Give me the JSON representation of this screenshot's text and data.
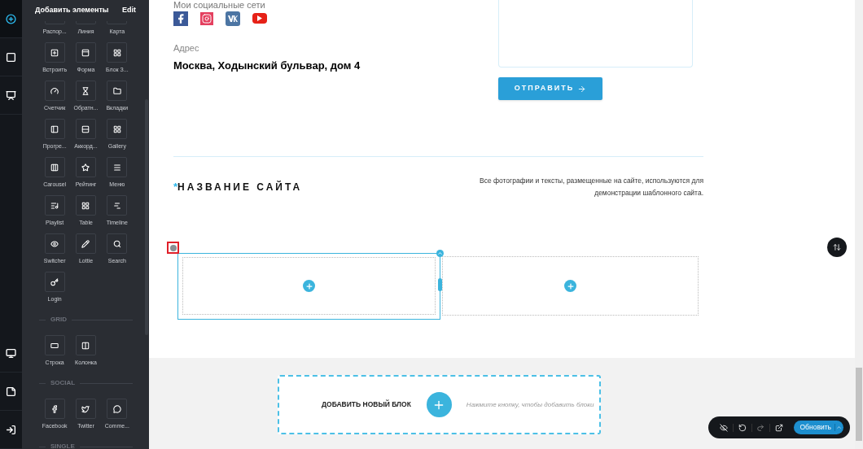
{
  "rail": {
    "top": [
      {
        "selected": true
      },
      {
        "selected": false
      },
      {
        "selected": false
      }
    ],
    "bottom": [
      {
        "selected": false
      },
      {
        "selected": false
      },
      {
        "selected": false
      }
    ]
  },
  "panel": {
    "title": "Добавить элементы",
    "edit": "Edit",
    "sections": [
      {
        "items": [
          {
            "label": "Распор..."
          },
          {
            "label": "Линия"
          },
          {
            "label": "Карта"
          },
          {
            "label": "Встроить"
          },
          {
            "label": "Форма"
          },
          {
            "label": "Блок З..."
          },
          {
            "label": "Счетчик"
          },
          {
            "label": "Обратн..."
          },
          {
            "label": "Вкладки"
          },
          {
            "label": "Прогре..."
          },
          {
            "label": "Аккорд..."
          },
          {
            "label": "Gallery"
          },
          {
            "label": "Carousel"
          },
          {
            "label": "Рейтинг"
          },
          {
            "label": "Меню"
          },
          {
            "label": "Playlist"
          },
          {
            "label": "Table"
          },
          {
            "label": "Timeline"
          },
          {
            "label": "Switcher"
          },
          {
            "label": "Lottie"
          },
          {
            "label": "Search"
          },
          {
            "label": "Login"
          }
        ]
      },
      {
        "heading": "GRID",
        "items": [
          {
            "label": "Строка"
          },
          {
            "label": "Колонка"
          }
        ]
      },
      {
        "heading": "SOCIAL",
        "items": [
          {
            "label": "Facebook"
          },
          {
            "label": "Twitter"
          },
          {
            "label": "Comme..."
          }
        ]
      },
      {
        "heading": "SINGLE"
      }
    ]
  },
  "contacts": {
    "social_heading": "Мои социальные сети",
    "address_label": "Адрес",
    "address": "Москва, Ходынский бульвар, дом 4",
    "submit": "ОТПРАВИТЬ"
  },
  "footer": {
    "brand_mark": "*",
    "brand": "НАЗВАНИЕ САЙТА",
    "disclaimer": "Все фотографии и тексты, размещенные на сайте, используются для демонстрации шаблонного сайта."
  },
  "row": {
    "columns": [
      {
        "selected": true
      },
      {
        "selected": false
      }
    ]
  },
  "add_block": {
    "label": "ДОБАВИТЬ НОВЫЙ БЛОК",
    "hint": "Нажмите кнопку, чтобы добавить блоки"
  },
  "toolbar": {
    "update": "Обновить"
  }
}
